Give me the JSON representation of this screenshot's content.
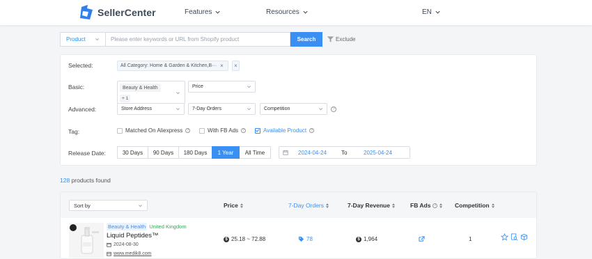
{
  "nav": {
    "brand": "SellerCenter",
    "features": "Features",
    "resources": "Resources",
    "lang": "EN"
  },
  "search": {
    "type": "Product",
    "placeholder": "Please enter keywords or URL from Shopify product",
    "button": "Search",
    "exclude": "Exclude"
  },
  "filters": {
    "selected_label": "Selected:",
    "selected_chip": "All Category: Home & Garden & Kitchen,B···",
    "basic_label": "Basic:",
    "basic_category_tag": "Beauty & Health",
    "basic_category_more": "+ 1",
    "price": "Price",
    "advanced_label": "Advanced:",
    "store_address": "Store Address",
    "orders_7day": "7-Day Orders",
    "competition": "Competition",
    "tag_label": "Tag:",
    "tags": [
      {
        "label": "Matched On Aliexpress",
        "checked": false
      },
      {
        "label": "With FB Ads",
        "checked": false
      },
      {
        "label": "Available Product",
        "checked": true
      }
    ],
    "release_label": "Release Date:",
    "periods": [
      "30 Days",
      "90 Days",
      "180 Days",
      "1 Year",
      "All Time"
    ],
    "active_period": "1 Year",
    "date_from": "2024-04-24",
    "date_to_label": "To",
    "date_to": "2025-04-24"
  },
  "results": {
    "count": "128",
    "found_text": "products found",
    "sort_placeholder": "Sort by",
    "columns": {
      "price": "Price",
      "orders": "7-Day Orders",
      "revenue": "7-Day Revenue",
      "fbads": "FB Ads",
      "competition": "Competition"
    },
    "rows": [
      {
        "category": "Beauty & Health",
        "country": "United Kingdom",
        "name": "Liquid Peptides™",
        "date": "2024-08-30",
        "site": "www.medik8.com",
        "price": "25.18 ~ 72.88",
        "orders": "78",
        "revenue": "1,964",
        "competition": "1"
      }
    ]
  },
  "colors": {
    "accent": "#3b8ff3",
    "country_tag": "#3aa35a"
  }
}
